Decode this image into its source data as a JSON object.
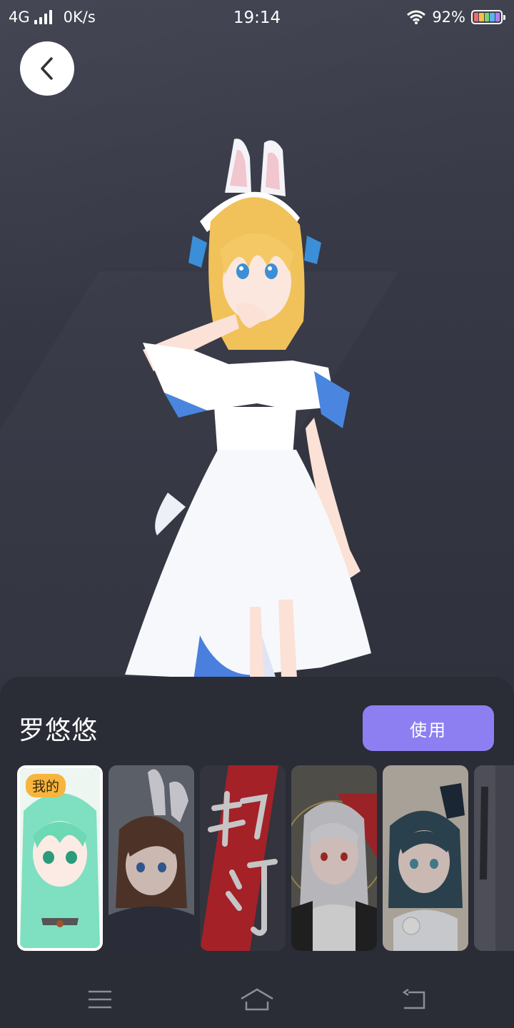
{
  "status_bar": {
    "network": "4G",
    "speed": "0K/s",
    "time": "19:14",
    "battery": "92%"
  },
  "header": {
    "back_icon": "chevron-left-icon"
  },
  "character": {
    "name": "罗悠悠",
    "use_label": "使用"
  },
  "avatars": [
    {
      "badge": "我的",
      "selected": true
    },
    {
      "selected": false
    },
    {
      "selected": false
    },
    {
      "selected": false
    },
    {
      "selected": false
    },
    {
      "selected": false
    }
  ],
  "nav_bar": {
    "menu_icon": "menu-icon",
    "home_icon": "home-icon",
    "back_icon": "back-arrow-icon"
  },
  "colors": {
    "accent": "#8d7ff2",
    "badge": "#f7b53d",
    "sheet": "#2a2c36"
  }
}
